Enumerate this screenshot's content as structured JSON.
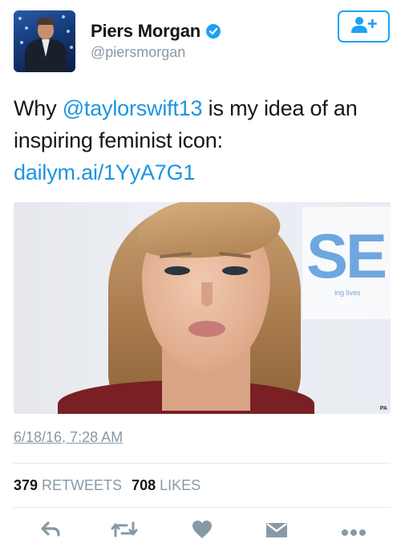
{
  "author": {
    "display_name": "Piers Morgan",
    "handle": "@piersmorgan",
    "verified": true
  },
  "follow_button": {
    "icon": "follow-user-icon"
  },
  "tweet": {
    "text_prefix": "Why ",
    "mention": "@taylorswift13",
    "text_suffix": " is my idea of an inspiring feminist icon:",
    "link": "dailym.ai/1YyA7G1"
  },
  "media": {
    "background_letters": "SE",
    "background_small": "ing lives",
    "watermark": "PA"
  },
  "timestamp": "6/18/16, 7:28 AM",
  "stats": {
    "retweets_count": "379",
    "retweets_label": "RETWEETS",
    "likes_count": "708",
    "likes_label": "LIKES"
  },
  "actions": [
    {
      "icon": "reply-icon"
    },
    {
      "icon": "retweet-icon"
    },
    {
      "icon": "like-heart-icon"
    },
    {
      "icon": "direct-message-icon"
    },
    {
      "icon": "more-options-icon"
    }
  ],
  "colors": {
    "accent": "#1da1f2",
    "link": "#1b95e0",
    "secondary_text": "#8899a6",
    "primary_text": "#14171a"
  }
}
